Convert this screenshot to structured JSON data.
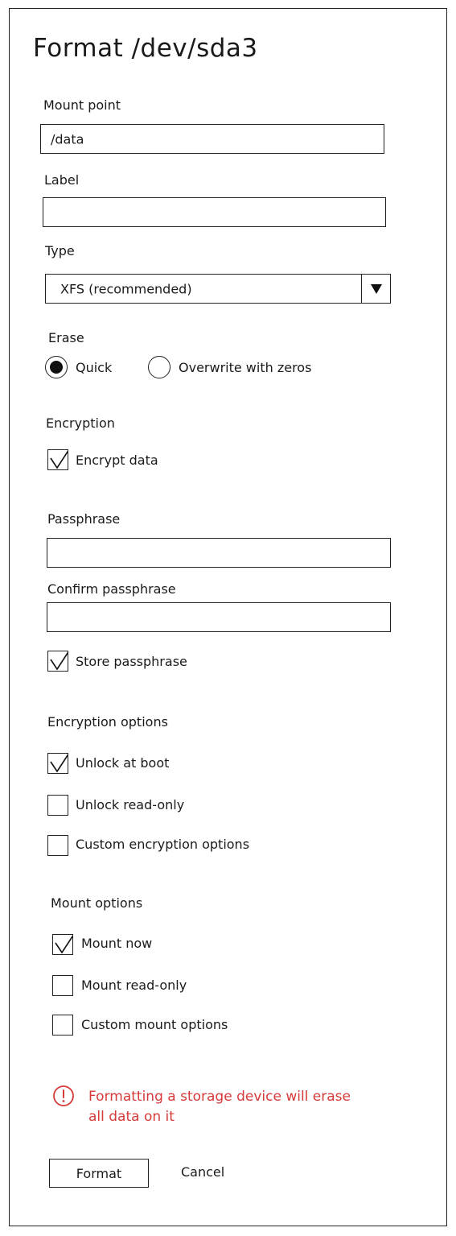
{
  "dialog": {
    "title": "Format /dev/sda3"
  },
  "mount_point": {
    "label": "Mount point",
    "value": "/data"
  },
  "label_field": {
    "label": "Label",
    "value": ""
  },
  "type": {
    "label": "Type",
    "selected": "XFS (recommended)",
    "arrow_icon": "triangle-down"
  },
  "erase": {
    "label": "Erase",
    "options": [
      {
        "label": "Quick",
        "selected": true
      },
      {
        "label": "Overwrite with zeros",
        "selected": false
      }
    ]
  },
  "encryption": {
    "label": "Encryption",
    "encrypt_data": {
      "label": "Encrypt data",
      "checked": true
    }
  },
  "passphrase": {
    "label": "Passphrase",
    "value": ""
  },
  "confirm_passphrase": {
    "label": "Confirm passphrase",
    "value": ""
  },
  "store_passphrase": {
    "label": "Store passphrase",
    "checked": true
  },
  "encryption_options": {
    "label": "Encryption options",
    "items": [
      {
        "label": "Unlock at boot",
        "checked": true
      },
      {
        "label": "Unlock read-only",
        "checked": false
      },
      {
        "label": "Custom encryption options",
        "checked": false
      }
    ]
  },
  "mount_options": {
    "label": "Mount options",
    "items": [
      {
        "label": "Mount now",
        "checked": true
      },
      {
        "label": "Mount read-only",
        "checked": false
      },
      {
        "label": "Custom mount options",
        "checked": false
      }
    ]
  },
  "warning": {
    "line1": "Formatting a storage device will erase",
    "line2": "all data on it",
    "color": "#d63a3a",
    "icon": "exclamation-circle"
  },
  "actions": {
    "format_label": "Format",
    "cancel_label": "Cancel"
  }
}
